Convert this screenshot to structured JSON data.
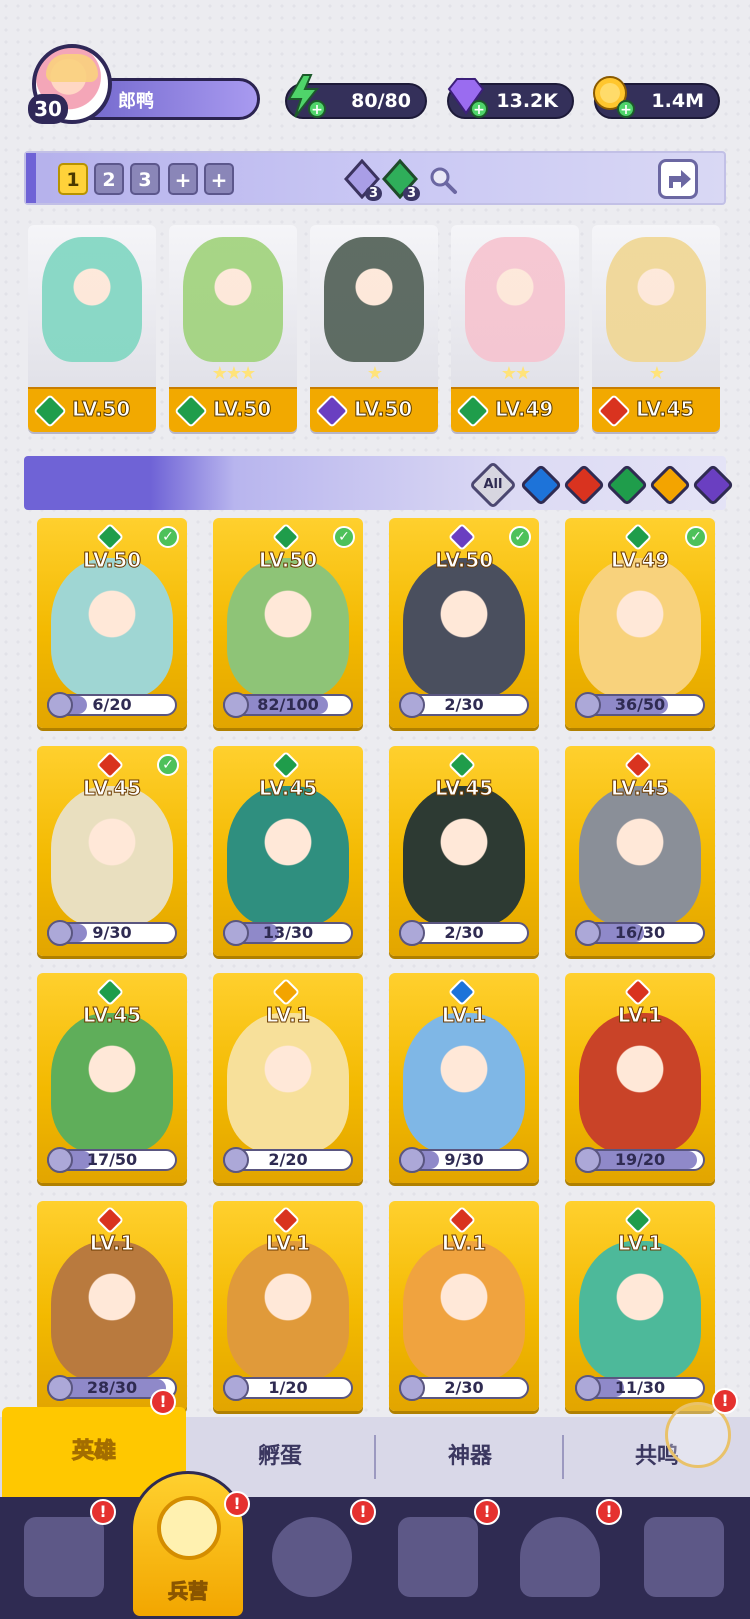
{
  "player": {
    "level": "30",
    "name": "郎鸭"
  },
  "resources": {
    "energy": "80/80",
    "gems": "13.2K",
    "gold": "1.4M"
  },
  "team": {
    "slots": [
      "1",
      "2",
      "3"
    ],
    "active_slot": "1",
    "gem_counts": [
      "3",
      "3"
    ]
  },
  "team_cards": [
    {
      "level": "LV.50",
      "element": "green",
      "stars": "",
      "art_color": "#7fd6c1"
    },
    {
      "level": "LV.50",
      "element": "green",
      "stars": "★★★",
      "art_color": "#9fd27a"
    },
    {
      "level": "LV.50",
      "element": "purple",
      "stars": "★",
      "art_color": "#4f5e54"
    },
    {
      "level": "LV.49",
      "element": "green",
      "stars": "★★",
      "art_color": "#f6c3cf"
    },
    {
      "level": "LV.45",
      "element": "red",
      "stars": "★",
      "art_color": "#f0d692"
    }
  ],
  "filters": {
    "all_label": "All",
    "elements": [
      "blue",
      "red",
      "green",
      "yellow",
      "purple"
    ]
  },
  "heroes": [
    {
      "level": "LV.50",
      "element": "green",
      "checked": true,
      "progress": "6/20",
      "ratio": 0.3,
      "art_color": "#9fd6d3"
    },
    {
      "level": "LV.50",
      "element": "green",
      "checked": true,
      "progress": "82/100",
      "ratio": 0.82,
      "art_color": "#8ec477"
    },
    {
      "level": "LV.50",
      "element": "purple",
      "checked": true,
      "progress": "2/30",
      "ratio": 0.07,
      "art_color": "#4a4f5e"
    },
    {
      "level": "LV.49",
      "element": "green",
      "checked": true,
      "progress": "36/50",
      "ratio": 0.72,
      "art_color": "#f8d27c"
    },
    {
      "level": "LV.45",
      "element": "red",
      "checked": true,
      "progress": "9/30",
      "ratio": 0.3,
      "art_color": "#e9dfbf"
    },
    {
      "level": "LV.45",
      "element": "green",
      "checked": false,
      "progress": "13/30",
      "ratio": 0.43,
      "art_color": "#2f8f7f"
    },
    {
      "level": "LV.45",
      "element": "green",
      "checked": false,
      "progress": "2/30",
      "ratio": 0.07,
      "art_color": "#2d3a33"
    },
    {
      "level": "LV.45",
      "element": "red",
      "checked": false,
      "progress": "16/30",
      "ratio": 0.53,
      "art_color": "#8a8f98"
    },
    {
      "level": "LV.45",
      "element": "green",
      "checked": false,
      "progress": "17/50",
      "ratio": 0.34,
      "art_color": "#5fae5a"
    },
    {
      "level": "LV.1",
      "element": "yellow",
      "checked": false,
      "progress": "2/20",
      "ratio": 0.1,
      "art_color": "#f7e09a"
    },
    {
      "level": "LV.1",
      "element": "blue",
      "checked": false,
      "progress": "9/30",
      "ratio": 0.3,
      "art_color": "#7fb7e6"
    },
    {
      "level": "LV.1",
      "element": "red",
      "checked": false,
      "progress": "19/20",
      "ratio": 0.95,
      "art_color": "#c94328"
    },
    {
      "level": "LV.1",
      "element": "red",
      "checked": false,
      "progress": "28/30",
      "ratio": 0.93,
      "art_color": "#b97a3e"
    },
    {
      "level": "LV.1",
      "element": "red",
      "checked": false,
      "progress": "1/20",
      "ratio": 0.05,
      "art_color": "#e09a3a"
    },
    {
      "level": "LV.1",
      "element": "red",
      "checked": false,
      "progress": "2/30",
      "ratio": 0.07,
      "art_color": "#f0a33f"
    },
    {
      "level": "LV.1",
      "element": "green",
      "checked": false,
      "progress": "11/30",
      "ratio": 0.37,
      "art_color": "#4db99a"
    }
  ],
  "subtabs": [
    "英雄",
    "孵蛋",
    "神器",
    "共鸣"
  ],
  "nav": {
    "active_label": "兵营"
  },
  "badge_mark": "!"
}
